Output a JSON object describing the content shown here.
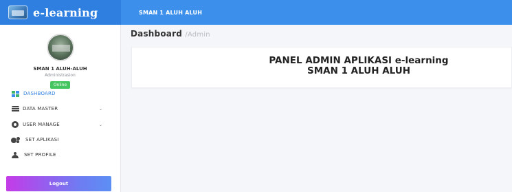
{
  "brand": {
    "name": "e-learning"
  },
  "topbar": {
    "school": "SMAN 1 ALUH ALUH"
  },
  "profile": {
    "name": "SMAN 1 ALUH-ALUH",
    "role": "Administrasion",
    "status": "Online"
  },
  "menu": {
    "items": [
      {
        "label": "DASHBOARD",
        "icon": "dashboard-icon",
        "active": true
      },
      {
        "label": "DATA MASTER",
        "icon": "database-icon",
        "has_chevron": true
      },
      {
        "label": "USER MANAGE",
        "icon": "gear-icon",
        "has_chevron": true
      },
      {
        "label": "SET APLIKASI",
        "icon": "gears-icon"
      },
      {
        "label": "SET PROFILE",
        "icon": "user-icon"
      }
    ],
    "chevron": "⌄"
  },
  "logout": {
    "label": "Logout"
  },
  "page": {
    "title": "Dashboard",
    "breadcrumb": "/Admin"
  },
  "panel": {
    "line1": "PANEL ADMIN APLIKASI e-learning",
    "line2": "SMAN 1 ALUH ALUH"
  },
  "colors": {
    "topbar": "#3c90ec",
    "brand_bg": "#2f7fe0",
    "accent": "#2f7fe0",
    "status_green": "#45c560",
    "logout_start": "#c43be8",
    "logout_end": "#5c8ff4"
  }
}
